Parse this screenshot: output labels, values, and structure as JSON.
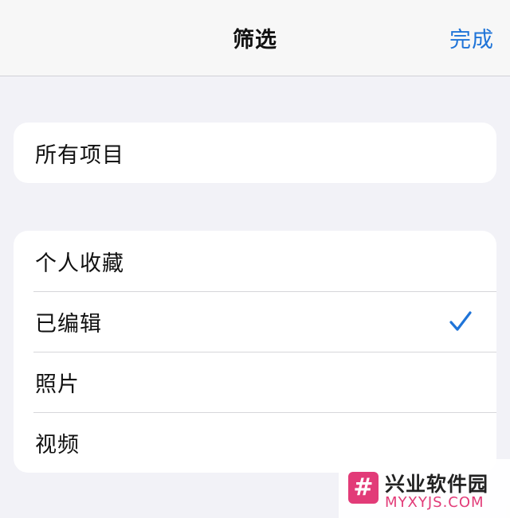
{
  "nav": {
    "title": "筛选",
    "done_label": "完成"
  },
  "group_all": {
    "items": [
      {
        "label": "所有项目",
        "checked": false
      }
    ]
  },
  "group_filters": {
    "items": [
      {
        "label": "个人收藏",
        "checked": false
      },
      {
        "label": "已编辑",
        "checked": true
      },
      {
        "label": "照片",
        "checked": false
      },
      {
        "label": "视频",
        "checked": false
      }
    ]
  },
  "watermark": {
    "logo_glyph": "#",
    "name": "兴业软件园",
    "site": "MYXYJS.COM"
  },
  "colors": {
    "accent": "#1f74d8",
    "background": "#f2f2f7",
    "watermark_brand": "#e23b78"
  },
  "icons": {
    "checkmark": "checkmark-icon"
  }
}
